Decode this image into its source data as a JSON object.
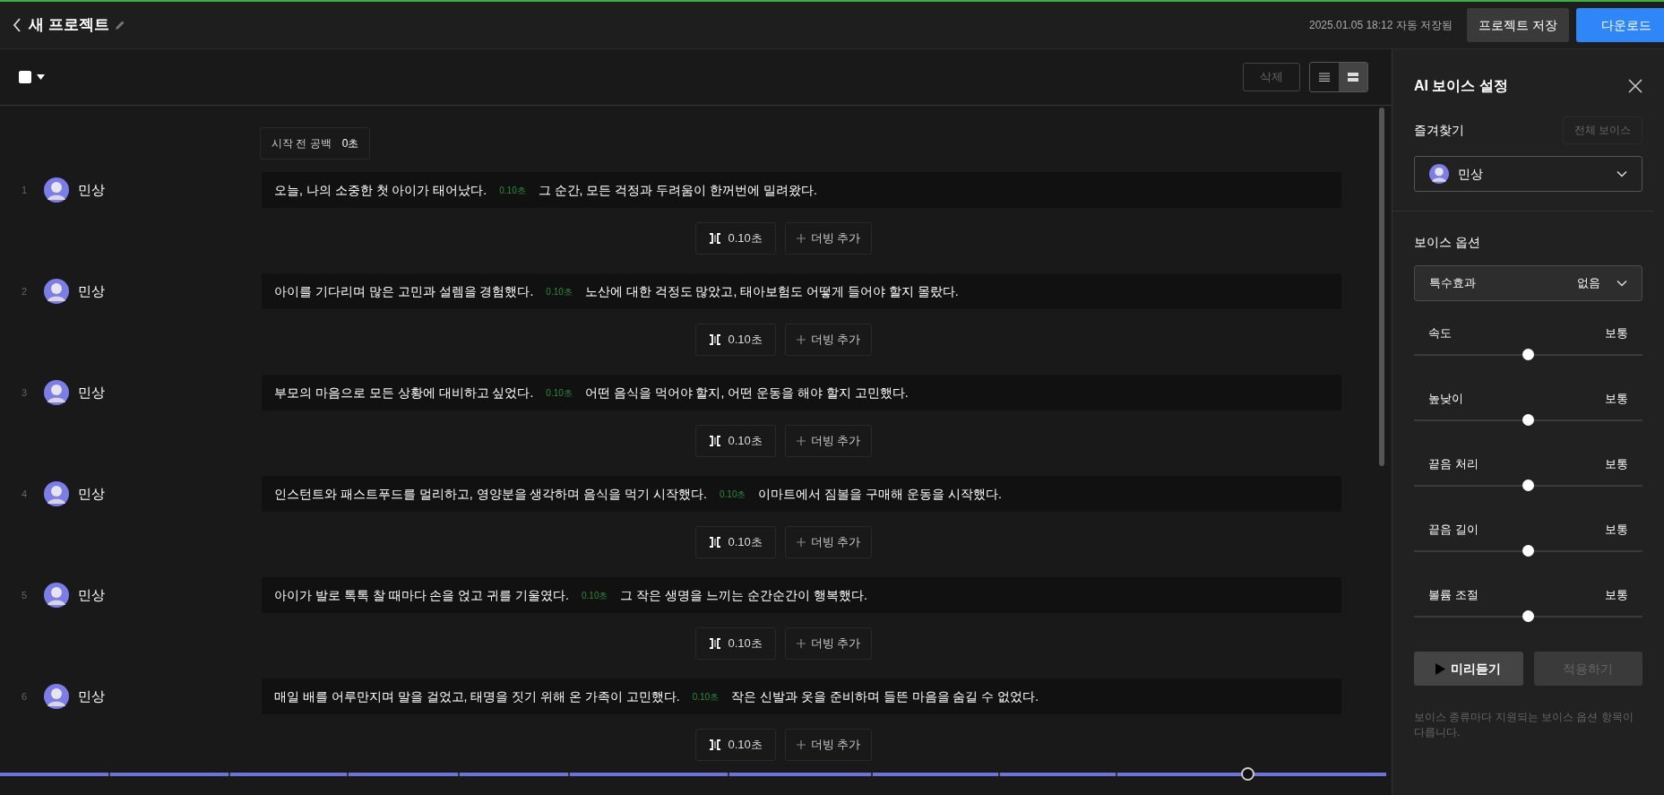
{
  "header": {
    "title": "새 프로젝트",
    "saved_status": "2025.01.05 18:12 자동 저장됨",
    "save_button": "프로젝트 저장",
    "download_button": "다운로드"
  },
  "toolbar": {
    "select_all_checked": false,
    "delete_button": {
      "label": "삭제",
      "disabled": true
    },
    "views": [
      {
        "kind": "list",
        "selected": false
      },
      {
        "kind": "block",
        "selected": true
      }
    ]
  },
  "lead_in": {
    "label": "시작 전 공백",
    "value": "0초"
  },
  "rows": [
    {
      "number": "1",
      "speaker": "민상",
      "sentences": [
        "오늘, 나의 소중한 첫 아이가 태어났다.",
        "그 순간, 모든 걱정과 두려움이 한꺼번에 밀려왔다."
      ],
      "pause": "0.10초",
      "gap": "0.10초",
      "dub": "더빙 추가"
    },
    {
      "number": "2",
      "speaker": "민상",
      "sentences": [
        "아이를 기다리며 많은 고민과 설렘을 경험했다.",
        "노산에 대한 걱정도 많았고, 태아보험도 어떻게 들어야 할지 몰랐다."
      ],
      "pause": "0.10초",
      "gap": "0.10초",
      "dub": "더빙 추가"
    },
    {
      "number": "3",
      "speaker": "민상",
      "sentences": [
        "부모의 마음으로 모든 상황에 대비하고 싶었다.",
        "어떤 음식을 먹어야 할지, 어떤 운동을 해야 할지 고민했다."
      ],
      "pause": "0.10초",
      "gap": "0.10초",
      "dub": "더빙 추가"
    },
    {
      "number": "4",
      "speaker": "민상",
      "sentences": [
        "인스턴트와 패스트푸드를 멀리하고, 영양분을 생각하며 음식을 먹기 시작했다.",
        "이마트에서 짐볼을 구매해 운동을 시작했다."
      ],
      "pause": "0.10초",
      "gap": "0.10초",
      "dub": "더빙 추가"
    },
    {
      "number": "5",
      "speaker": "민상",
      "sentences": [
        "아이가 발로 톡톡 찰 때마다 손을 얹고 귀를 기울였다.",
        "그 작은 생명을 느끼는 순간순간이 행복했다."
      ],
      "pause": "0.10초",
      "gap": "0.10초",
      "dub": "더빙 추가"
    },
    {
      "number": "6",
      "speaker": "민상",
      "sentences": [
        "매일 배를 어루만지며 말을 걸었고, 태명을 짓기 위해 온 가족이 고민했다.",
        "작은 신발과 옷을 준비하며 들뜬 마음을 숨길 수 없었다."
      ],
      "pause": "0.10초",
      "gap": "0.10초",
      "dub": "더빙 추가"
    }
  ],
  "timeline": {
    "level": 0.9
  },
  "panel": {
    "title": "AI 보이스 설정",
    "favorites_label": "즐겨찾기",
    "all_voices_button": "전체 보이스",
    "voice": "민상",
    "options_label": "보이스 옵션",
    "effect": {
      "label": "특수효과",
      "value": "없음"
    },
    "sliders": [
      {
        "label": "속도",
        "value": "보통",
        "level": 0.5
      },
      {
        "label": "높낮이",
        "value": "보통",
        "level": 0.5
      },
      {
        "label": "끝음 처리",
        "value": "보통",
        "level": 0.5
      },
      {
        "label": "끝음 길이",
        "value": "보통",
        "level": 0.5
      },
      {
        "label": "볼륨 조절",
        "value": "보통",
        "level": 0.5
      }
    ],
    "preview_button": "미리듣기",
    "apply_button": {
      "label": "적용하기",
      "disabled": true
    },
    "note": "보이스 종류마다 지원되는 보이스 옵션 항목이 다릅니다."
  }
}
